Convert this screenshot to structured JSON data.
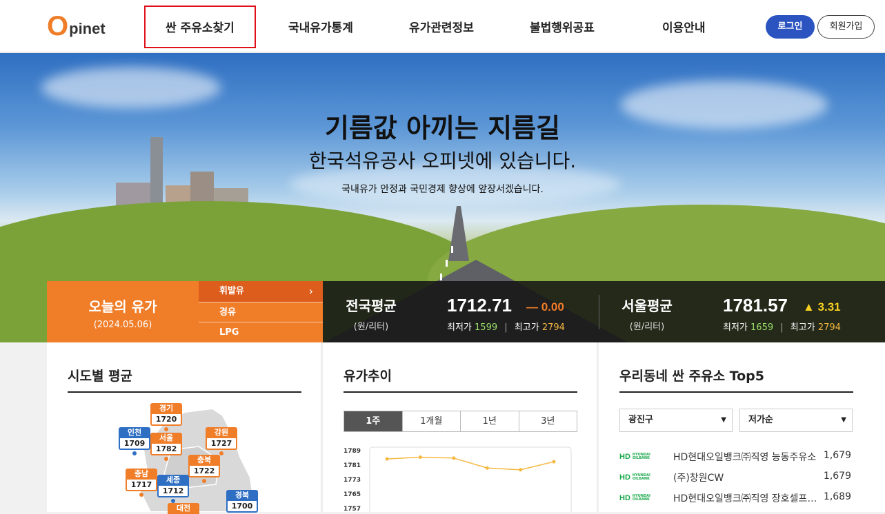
{
  "header": {
    "logo_o": "O",
    "logo_rest": "pinet",
    "nav": [
      "싼 주유소찾기",
      "국내유가통계",
      "유가관련정보",
      "불법행위공표",
      "이용안내"
    ],
    "login": "로그인",
    "join": "회원가입"
  },
  "hero": {
    "title": "기름값 아끼는 지름길",
    "subtitle": "한국석유공사 오피넷에 있습니다.",
    "small": "국내유가 안정과 국민경제 향상에 앞장서겠습니다."
  },
  "today": {
    "title": "오늘의 유가",
    "date": "(2024.05.06)",
    "fuels": [
      "휘발유",
      "경유",
      "LPG"
    ],
    "arrow": "›"
  },
  "national": {
    "label": "전국평균",
    "unit": "(원/리터)",
    "price": "1712.71",
    "diff": "— 0.00",
    "min_label": "최저가",
    "min": "1599",
    "max_label": "최고가",
    "max": "2794",
    "sep": "|"
  },
  "seoul": {
    "label": "서울평균",
    "unit": "(원/리터)",
    "price": "1781.57",
    "diff": "▲ 3.31",
    "min_label": "최저가",
    "min": "1659",
    "max_label": "최고가",
    "max": "2794",
    "sep": "|"
  },
  "sido": {
    "title": "시도별 평균",
    "regions": [
      {
        "name": "경기",
        "value": "1720"
      },
      {
        "name": "인천",
        "value": "1709"
      },
      {
        "name": "서울",
        "value": "1782"
      },
      {
        "name": "강원",
        "value": "1727"
      },
      {
        "name": "충북",
        "value": "1722"
      },
      {
        "name": "충남",
        "value": "1717"
      },
      {
        "name": "세종",
        "value": "1712"
      },
      {
        "name": "경북",
        "value": "1700"
      },
      {
        "name": "대전",
        "value": ""
      }
    ]
  },
  "trend": {
    "title": "유가추이",
    "periods": [
      "1주",
      "1개월",
      "1년",
      "3년"
    ]
  },
  "chart_data": {
    "type": "line",
    "y_ticks": [
      1789,
      1781,
      1773,
      1765,
      1757
    ],
    "ylim": [
      1757,
      1789
    ],
    "values": [
      1784,
      1785,
      1784.5,
      1779,
      1778,
      1782.5
    ],
    "color": "#f5b840"
  },
  "top5": {
    "title": "우리동네 싼 주유소 Top5",
    "region_select": "광진구",
    "sort_select": "저가순",
    "caret": "▼",
    "stations": [
      {
        "brand": "HD",
        "brand_sub1": "HYUNDAI",
        "brand_sub2": "OILBANK",
        "name": "HD현대오일뱅크㈜직영 능동주유소",
        "price": "1,679"
      },
      {
        "brand": "HD",
        "brand_sub1": "HYUNDAI",
        "brand_sub2": "OILBANK",
        "name": "(주)창원CW",
        "price": "1,679"
      },
      {
        "brand": "HD",
        "brand_sub1": "HYUNDAI",
        "brand_sub2": "OILBANK",
        "name": "HD현대오일뱅크㈜직영 장호셀프주유소",
        "price": "1,689"
      }
    ]
  }
}
